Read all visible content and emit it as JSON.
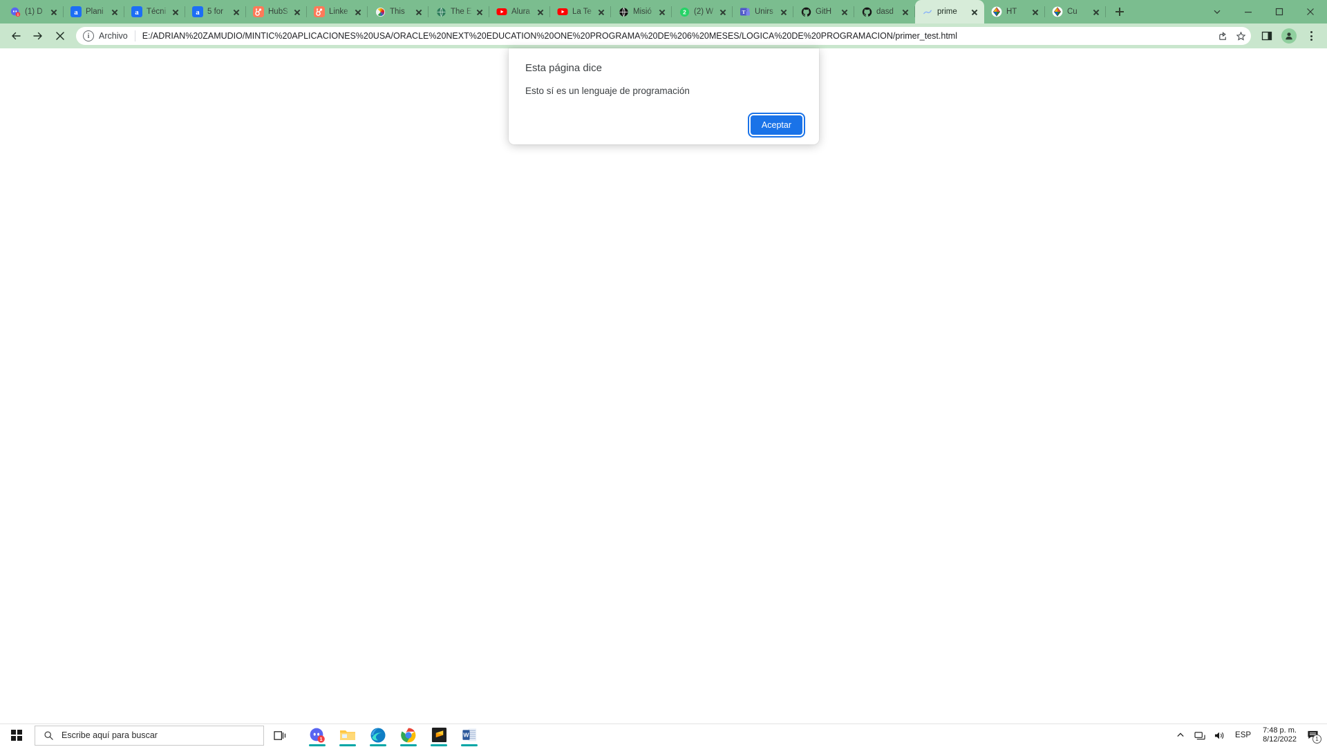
{
  "browser": {
    "tabs": [
      {
        "title": "(1) D",
        "icon": "discord-icon",
        "icon_color": "#5865f2",
        "active": false
      },
      {
        "title": "Plani",
        "icon": "alura-icon",
        "icon_color": "#1d6ef5",
        "active": false
      },
      {
        "title": "Técni",
        "icon": "alura-icon",
        "icon_color": "#1d6ef5",
        "active": false
      },
      {
        "title": "5 for",
        "icon": "alura-icon",
        "icon_color": "#1d6ef5",
        "active": false
      },
      {
        "title": "HubS",
        "icon": "hubspot-icon",
        "icon_color": "#ff7a59",
        "active": false
      },
      {
        "title": "Linke",
        "icon": "hubspot-icon",
        "icon_color": "#ff7a59",
        "active": false
      },
      {
        "title": "This ",
        "icon": "nbc-icon",
        "icon_color": "#f0f0f0",
        "active": false
      },
      {
        "title": "The E",
        "icon": "globe-icon",
        "icon_color": "#2f7d5c",
        "active": false
      },
      {
        "title": "Alura",
        "icon": "youtube-icon",
        "icon_color": "#ff0000",
        "active": false
      },
      {
        "title": "La Te",
        "icon": "youtube-icon",
        "icon_color": "#ff0000",
        "active": false
      },
      {
        "title": "Misió",
        "icon": "globe-dark-icon",
        "icon_color": "#111111",
        "active": false
      },
      {
        "title": "(2) W",
        "icon": "whatsapp-icon",
        "icon_color": "#25d366",
        "active": false
      },
      {
        "title": "Unirs",
        "icon": "teams-icon",
        "icon_color": "#5059c9",
        "active": false
      },
      {
        "title": "GitH",
        "icon": "github-icon",
        "icon_color": "#181717",
        "active": false
      },
      {
        "title": "dasd",
        "icon": "github-icon",
        "icon_color": "#181717",
        "active": false
      },
      {
        "title": "prime",
        "icon": "file-icon",
        "icon_color": "#8ab4f8",
        "active": true
      },
      {
        "title": "HT",
        "icon": "kite-play-icon",
        "icon_color": "#ffffff",
        "active": false
      },
      {
        "title": "Cu",
        "icon": "kite-icon",
        "icon_color": "#ffffff",
        "active": false
      }
    ],
    "new_tab_label": "+",
    "window_controls": {
      "chevron": "chevron-down-icon",
      "minimize": "minimize-icon",
      "maximize": "maximize-icon",
      "close": "close-icon"
    },
    "toolbar": {
      "back": "back-arrow-icon",
      "forward": "forward-arrow-icon",
      "stop": "stop-loading-icon",
      "share": "share-icon",
      "bookmark": "star-icon",
      "sidepanel": "side-panel-icon",
      "profile": "profile-avatar-icon",
      "menu": "three-dot-menu-icon"
    },
    "omnibox": {
      "info_icon": "info-circle-icon",
      "scheme_label": "Archivo",
      "url": "E:/ADRIAN%20ZAMUDIO/MINTIC%20APLICACIONES%20USA/ORACLE%20NEXT%20EDUCATION%20ONE%20PROGRAMA%20DE%206%20MESES/LOGICA%20DE%20PROGRAMACION/primer_test.html"
    }
  },
  "dialog": {
    "title": "Esta página dice",
    "message": "Esto sí es un lenguaje de programación",
    "accept_label": "Aceptar",
    "accent_color": "#1a73e8"
  },
  "taskbar": {
    "start_label": "start-button",
    "search_placeholder": "Escribe aquí para buscar",
    "task_view": "task-view-icon",
    "apps": [
      {
        "name": "discord",
        "badge": "1"
      },
      {
        "name": "file-explorer",
        "badge": ""
      },
      {
        "name": "microsoft-edge",
        "badge": ""
      },
      {
        "name": "google-chrome",
        "badge": ""
      },
      {
        "name": "sublime-text",
        "badge": ""
      },
      {
        "name": "microsoft-word",
        "badge": ""
      }
    ],
    "tray": {
      "overflow": "chevron-up-icon",
      "network": "network-icon",
      "volume": "volume-icon",
      "language": "ESP",
      "time": "7:48 p. m.",
      "date": "8/12/2022",
      "notifications_badge": "1"
    }
  }
}
